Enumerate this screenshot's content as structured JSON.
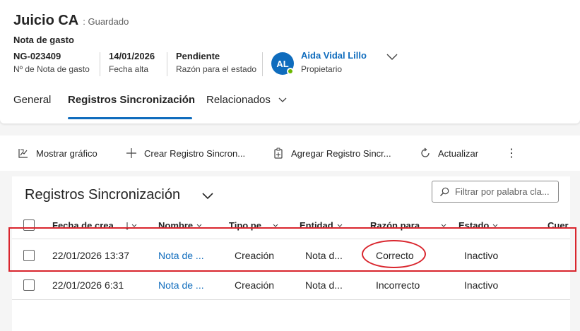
{
  "record": {
    "title": "Juicio CA",
    "save_status": ": Guardado",
    "entity_type": "Nota de gasto",
    "fields": [
      {
        "value": "NG-023409",
        "label": "Nº de Nota de gasto"
      },
      {
        "value": "14/01/2026",
        "label": "Fecha alta"
      },
      {
        "value": "Pendiente",
        "label": "Razón para el estado"
      }
    ],
    "owner": {
      "initials": "AL",
      "name": "Aida Vidal Lillo",
      "label": "Propietario",
      "presence_color": "#6bb700"
    }
  },
  "tabs": [
    {
      "label": "General",
      "active": false
    },
    {
      "label": "Registros Sincronización",
      "active": true
    },
    {
      "label": "Relacionados",
      "active": false
    }
  ],
  "commands": [
    {
      "label": "Mostrar gráfico",
      "icon": "chart-icon"
    },
    {
      "label": "Crear Registro Sincron...",
      "icon": "plus-icon"
    },
    {
      "label": "Agregar Registro Sincr...",
      "icon": "clipboard-add-icon"
    },
    {
      "label": "Actualizar",
      "icon": "refresh-icon"
    },
    {
      "label": "⋮",
      "icon": "more-icon"
    }
  ],
  "grid": {
    "title": "Registros Sincronización",
    "filter_placeholder": "Filtrar por palabra cla...",
    "columns": [
      "Fecha de crea...",
      "Nombre",
      "Tipo pe...",
      "Entidad",
      "Razón para ...",
      "Estado",
      "Cuer"
    ],
    "rows": [
      {
        "fecha": "22/01/2026 13:37",
        "nombre": "Nota de ...",
        "tipo": "Creación",
        "entidad": "Nota d...",
        "razon": "Correcto",
        "estado": "Inactivo"
      },
      {
        "fecha": "22/01/2026 6:31",
        "nombre": "Nota de ...",
        "tipo": "Creación",
        "entidad": "Nota d...",
        "razon": "Incorrecto",
        "estado": "Inactivo"
      }
    ]
  },
  "colors": {
    "accent": "#0f6cbd",
    "annotation": "#d9252d"
  }
}
